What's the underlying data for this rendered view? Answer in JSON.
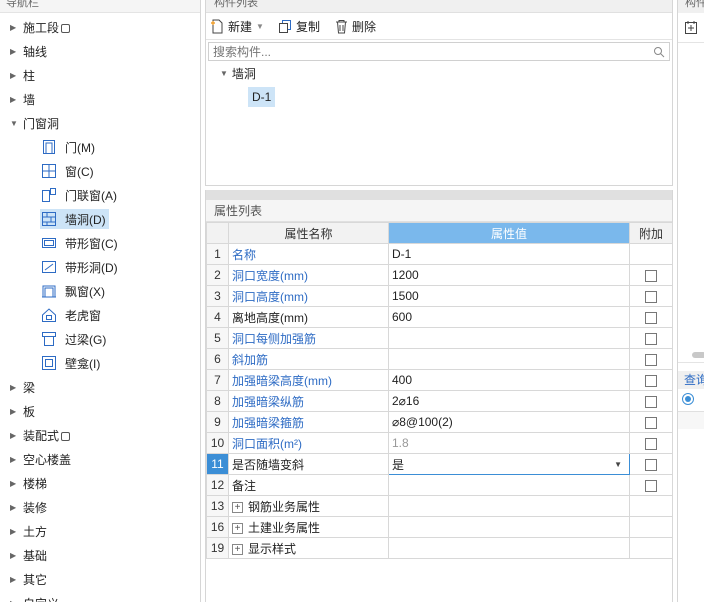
{
  "nav": {
    "title": "导航栏",
    "items": [
      {
        "label": "施工段",
        "locked": true,
        "top": 0
      },
      {
        "label": "轴线"
      },
      {
        "label": "柱"
      },
      {
        "label": "墙"
      },
      {
        "label": "门窗洞",
        "expanded": true
      }
    ],
    "sub_items": [
      {
        "label": "门(M)",
        "icon": "door-icon"
      },
      {
        "label": "窗(C)",
        "icon": "window-icon"
      },
      {
        "label": "门联窗(A)",
        "icon": "door-window-icon"
      },
      {
        "label": "墙洞(D)",
        "icon": "wall-opening-icon",
        "selected": true
      },
      {
        "label": "带形窗(C)",
        "icon": "strip-window-icon"
      },
      {
        "label": "带形洞(D)",
        "icon": "strip-opening-icon"
      },
      {
        "label": "飘窗(X)",
        "icon": "bay-window-icon"
      },
      {
        "label": "老虎窗",
        "icon": "dormer-window-icon"
      },
      {
        "label": "过梁(G)",
        "icon": "lintel-icon"
      },
      {
        "label": "壁龛(I)",
        "icon": "niche-icon"
      }
    ],
    "items_after": [
      {
        "label": "梁"
      },
      {
        "label": "板"
      },
      {
        "label": "装配式",
        "locked": true
      },
      {
        "label": "空心楼盖"
      },
      {
        "label": "楼梯"
      },
      {
        "label": "装修"
      },
      {
        "label": "土方"
      },
      {
        "label": "基础"
      },
      {
        "label": "其它"
      },
      {
        "label": "自定义"
      }
    ]
  },
  "components": {
    "title": "构件列表",
    "new_label": "新建",
    "copy_label": "复制",
    "delete_label": "删除",
    "search_placeholder": "搜索构件...",
    "tree_root": "墙洞",
    "tree_leaf": "D-1"
  },
  "properties": {
    "title": "属性列表",
    "col_name": "属性名称",
    "col_value": "属性值",
    "col_extra": "附加",
    "rows": [
      {
        "num": "1",
        "name": "名称",
        "value": "D-1",
        "blue": true,
        "checkbox": false
      },
      {
        "num": "2",
        "name": "洞口宽度(mm)",
        "value": "1200",
        "blue": true,
        "checkbox": true
      },
      {
        "num": "3",
        "name": "洞口高度(mm)",
        "value": "1500",
        "blue": true,
        "checkbox": true
      },
      {
        "num": "4",
        "name": "离地高度(mm)",
        "value": "600",
        "blue": false,
        "checkbox": true
      },
      {
        "num": "5",
        "name": "洞口每侧加强筋",
        "value": "",
        "blue": true,
        "checkbox": true
      },
      {
        "num": "6",
        "name": "斜加筋",
        "value": "",
        "blue": true,
        "checkbox": true
      },
      {
        "num": "7",
        "name": "加强暗梁高度(mm)",
        "value": "400",
        "blue": true,
        "checkbox": true
      },
      {
        "num": "8",
        "name": "加强暗梁纵筋",
        "value": "2⌀16",
        "blue": true,
        "checkbox": true
      },
      {
        "num": "9",
        "name": "加强暗梁箍筋",
        "value": "⌀8@100(2)",
        "blue": true,
        "checkbox": true
      },
      {
        "num": "10",
        "name": "洞口面积(m²)",
        "value": "1.8",
        "blue": true,
        "checkbox": true,
        "gray": true
      },
      {
        "num": "11",
        "name": "是否随墙变斜",
        "value": "是",
        "blue": false,
        "checkbox": true,
        "active": true,
        "dropdown": true
      },
      {
        "num": "12",
        "name": "备注",
        "value": "",
        "blue": false,
        "checkbox": true
      }
    ],
    "groups": [
      {
        "num": "13",
        "name": "钢筋业务属性"
      },
      {
        "num": "16",
        "name": "土建业务属性"
      },
      {
        "num": "19",
        "name": "显示样式"
      }
    ]
  },
  "right_panel": {
    "title": "构件做法",
    "query_label": "查询"
  }
}
